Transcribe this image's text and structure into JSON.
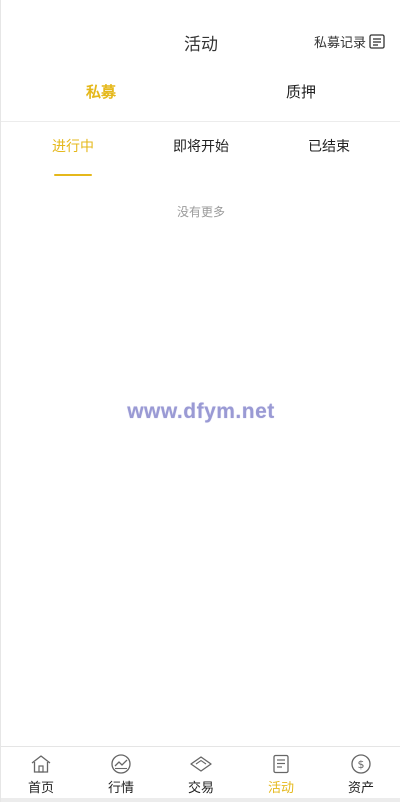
{
  "header": {
    "title": "活动",
    "record_label": "私募记录",
    "record_icon": "document-list-icon"
  },
  "main_tabs": [
    {
      "label": "私募",
      "active": true
    },
    {
      "label": "质押",
      "active": false
    }
  ],
  "sub_tabs": [
    {
      "label": "进行中",
      "active": true
    },
    {
      "label": "即将开始",
      "active": false
    },
    {
      "label": "已结束",
      "active": false
    }
  ],
  "list_status": "没有更多",
  "watermark": "www.dfym.net",
  "bottom_nav": [
    {
      "label": "首页",
      "icon": "home-icon",
      "active": false
    },
    {
      "label": "行情",
      "icon": "market-chart-icon",
      "active": false
    },
    {
      "label": "交易",
      "icon": "trade-diamond-icon",
      "active": false
    },
    {
      "label": "活动",
      "icon": "activity-document-icon",
      "active": true
    },
    {
      "label": "资产",
      "icon": "dollar-coin-icon",
      "active": false
    }
  ],
  "colors": {
    "accent": "#e5b81b",
    "text": "#222222",
    "muted": "#9a9a9a",
    "watermark": "#9a9ad4"
  }
}
